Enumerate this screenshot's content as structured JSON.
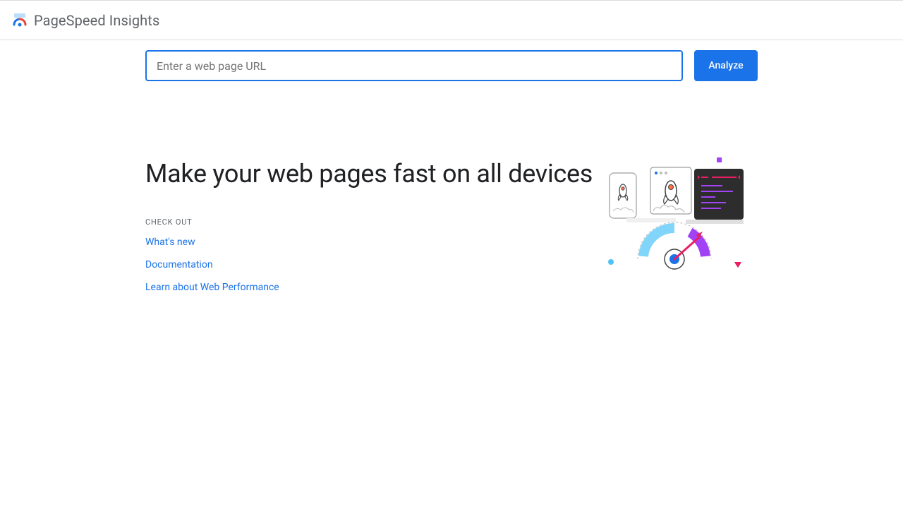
{
  "header": {
    "title": "PageSpeed Insights"
  },
  "search": {
    "placeholder": "Enter a web page URL",
    "button_label": "Analyze"
  },
  "main": {
    "headline": "Make your web pages fast on all devices",
    "checkout_label": "CHECK OUT",
    "links": [
      {
        "label": "What's new"
      },
      {
        "label": "Documentation"
      },
      {
        "label": "Learn about Web Performance"
      }
    ]
  }
}
